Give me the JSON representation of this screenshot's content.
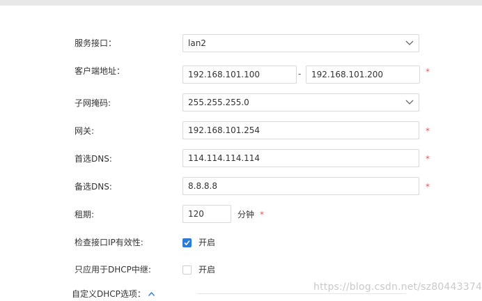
{
  "form": {
    "service_interface": {
      "label": "服务接口：",
      "value": "lan2"
    },
    "client_address": {
      "label": "客户端地址：",
      "start": "192.168.101.100",
      "separator": "-",
      "end": "192.168.101.200",
      "required": "*"
    },
    "subnet_mask": {
      "label": "子网掩码:",
      "value": "255.255.255.0"
    },
    "gateway": {
      "label": "网关:",
      "value": "192.168.101.254",
      "required": "*"
    },
    "primary_dns": {
      "label": "首选DNS:",
      "value": "114.114.114.114",
      "required": "*"
    },
    "secondary_dns": {
      "label": "备选DNS:",
      "value": "8.8.8.8",
      "required": "*"
    },
    "lease": {
      "label": "租期:",
      "value": "120",
      "unit": "分钟",
      "required": "*"
    },
    "check_ip_validity": {
      "label": "检查接口IP有效性:",
      "checked": true,
      "option_label": "开启"
    },
    "dhcp_relay_only": {
      "label": "只应用于DHCP中继:",
      "checked": false,
      "option_label": "开启"
    },
    "custom_options": {
      "label": "自定义DHCP选项："
    }
  },
  "watermark": "https://blog.csdn.net/sz80443374",
  "colors": {
    "accent": "#2e7bd6",
    "required": "#e05a5a",
    "border": "#d9d9d9"
  },
  "icons": {
    "select": "chevron-down-icon",
    "section": "chevron-up-icon",
    "check": "check-icon"
  }
}
